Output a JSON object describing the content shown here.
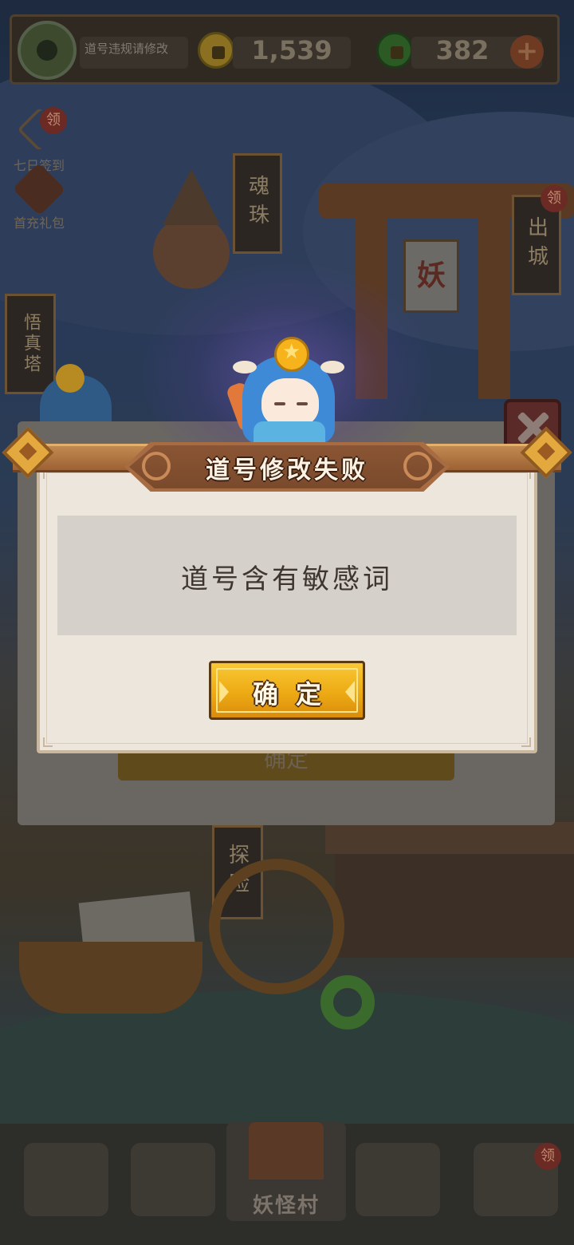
{
  "top_bar": {
    "name_hint": "道号违规请修改",
    "gold_amount": "1,539",
    "jade_amount": "382",
    "plus_label": "+"
  },
  "side_icons": [
    {
      "label": "七日签到",
      "badge": "领"
    },
    {
      "label": "首充礼包",
      "badge": ""
    }
  ],
  "map_signs": {
    "soul_orb": "魂珠",
    "exit_city": "出城",
    "tower": "悟真塔",
    "explore": "探险",
    "yao": "妖",
    "exit_badge": "领"
  },
  "bottom_nav": {
    "active_label": "妖怪村",
    "right_badge": "领"
  },
  "background_dialog": {
    "button_label": "确定"
  },
  "dialog": {
    "title": "道号修改失败",
    "message": "道号含有敏感词",
    "confirm_label": "确定"
  },
  "colors": {
    "header_brown": "#8a5534",
    "confirm_gold": "#edaa14",
    "dialog_bg": "#ece6dc",
    "message_box": "#d5d0ca",
    "close_red": "#5a2a28"
  },
  "icons": [
    "gold-coin-icon",
    "jade-coin-icon",
    "plus-icon",
    "close-icon",
    "avatar-icon",
    "star-orb-icon"
  ]
}
